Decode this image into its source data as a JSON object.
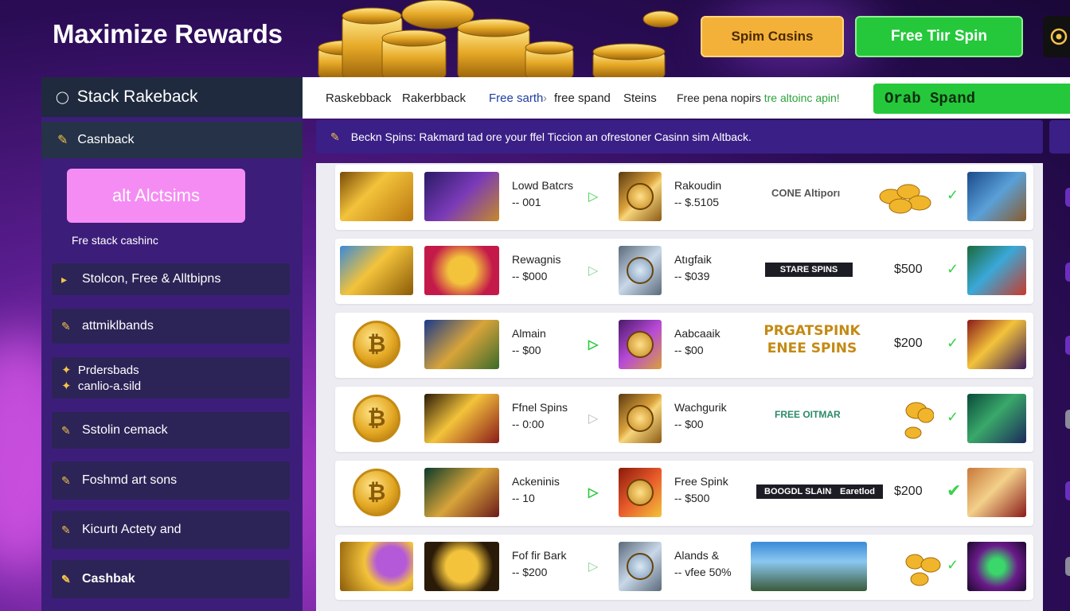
{
  "header": {
    "title": "Maximize Rewards",
    "spin_button": "Spim Cɑsins",
    "free_button": "Free Tiır Spin"
  },
  "sidebar": {
    "title": "Stack Rakeback",
    "cashback": "Casnback",
    "promo_button": "alt Alctsims",
    "promo_sub": "Fre stack cashinc",
    "items": [
      {
        "label": "Stolcon, Free & Alltbipns"
      },
      {
        "label": "attmiklbands"
      },
      {
        "label": "Prdersbads",
        "label2": "canlio-a.sild"
      },
      {
        "label": "Sstolin cemack"
      },
      {
        "label": "Foshmd art sons"
      },
      {
        "label": "Kicurtı Actety and"
      },
      {
        "label": "Cashbak"
      }
    ]
  },
  "tabs": {
    "items": [
      "Raskebback",
      "Rakerbback",
      "Free sarth",
      "free spand",
      "Steins"
    ],
    "promo_prefix": "Free pena nopirs",
    "promo_highlight": "tre altoinc apin!",
    "grab_button": "Orab Spand"
  },
  "notice": {
    "text": "Beckn Spins: Rakmard tad ore your ffel Ticcion an ofrestoner Casinn sim Altback."
  },
  "rows": [
    {
      "title": "Lowd Batcrs",
      "value": "-- 001",
      "title2": "Rakoudin",
      "value2": "-- $.5105",
      "mid": "CONE Altiporı",
      "amount": ""
    },
    {
      "title": "Rewagnis",
      "value": "-- $000",
      "title2": "Atıgfaik",
      "value2": "-- $039",
      "mid": "STARE SPINS",
      "amount": "$500"
    },
    {
      "title": "Almain",
      "value": "-- $00",
      "title2": "Aabcaaik",
      "value2": "-- $00",
      "mid": "PRGATSPINK ENEE SPINS",
      "amount": "$200"
    },
    {
      "title": "Ffnel Spins",
      "value": "-- 0:00",
      "title2": "Wachgurik",
      "value2": "-- $00",
      "mid": "FREE OITMAR",
      "amount": ""
    },
    {
      "title": "Ackeninis",
      "value": "-- 10",
      "title2": "Free Spink",
      "value2": "-- $500",
      "mid": "BOOGDL SLAINS",
      "mid2": "Earetlod",
      "amount": "$200"
    },
    {
      "title": "Fof fir Bark",
      "value": "-- $200",
      "title2": "Alands &",
      "value2": "-- vfee 50%",
      "mid": "",
      "amount": ""
    }
  ],
  "colors": {
    "accent_green": "#25c83a",
    "accent_gold": "#f4b13a",
    "sidebar_purple": "#3d1d7a",
    "pink": "#f58cf3"
  }
}
